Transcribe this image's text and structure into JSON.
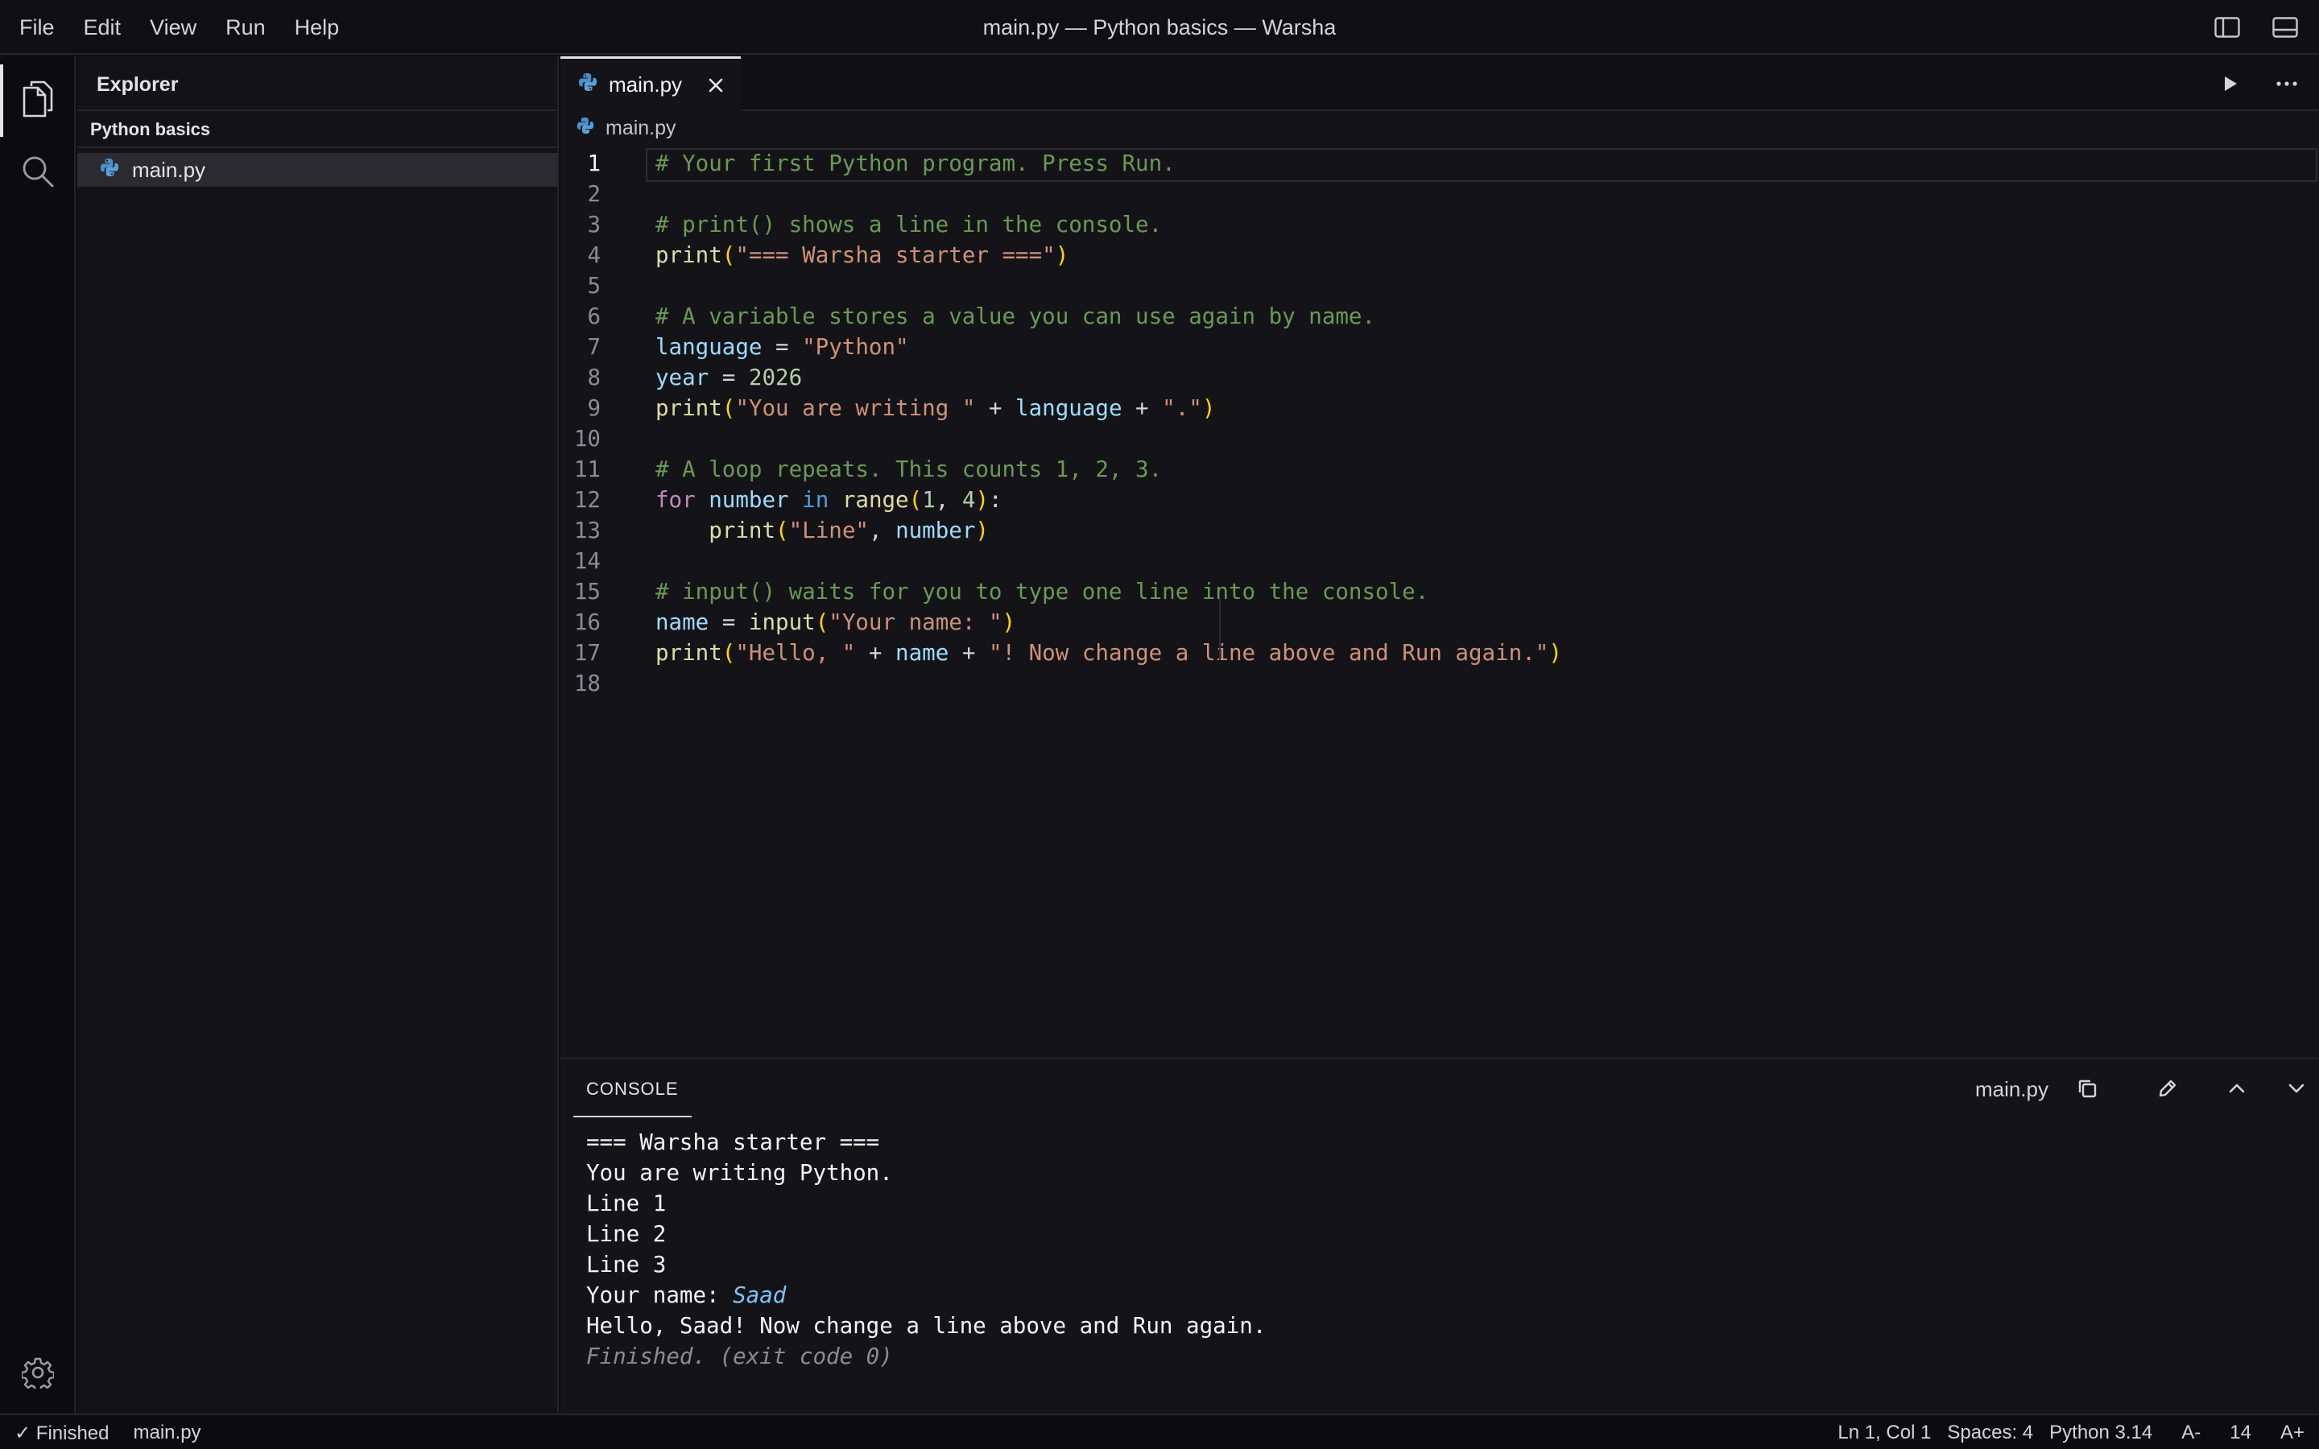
{
  "menu": [
    "File",
    "Edit",
    "View",
    "Run",
    "Help"
  ],
  "window_title": "main.py — Python basics — Warsha",
  "sidebar": {
    "header": "Explorer",
    "project": "Python basics",
    "files": [
      "main.py"
    ]
  },
  "editor": {
    "tab_label": "main.py",
    "breadcrumb": "main.py",
    "line_numbers": [
      "1",
      "2",
      "3",
      "4",
      "5",
      "6",
      "7",
      "8",
      "9",
      "10",
      "11",
      "12",
      "13",
      "14",
      "15",
      "16",
      "17",
      "18"
    ],
    "lines": [
      "# Your first Python program. Press Run.",
      "",
      "# print() shows a line in the console.",
      "print(\"=== Warsha starter ===\")",
      "",
      "# A variable stores a value you can use again by name.",
      "language = \"Python\"",
      "year = 2026",
      "print(\"You are writing \" + language + \".\")",
      "",
      "# A loop repeats. This counts 1, 2, 3.",
      "for number in range(1, 4):",
      "    print(\"Line\", number)",
      "",
      "# input() waits for you to type one line into the console.",
      "name = input(\"Your name: \")",
      "print(\"Hello, \" + name + \"! Now change a line above and Run again.\")",
      ""
    ],
    "tokens": {
      "c1": "# Your first Python program. Press Run.",
      "c3": "# print() shows a line in the console.",
      "c6": "# A variable stores a value you can use again by name.",
      "c11": "# A loop repeats. This counts 1, 2, 3.",
      "c15": "# input() waits for you to type one line into the console.",
      "print": "print",
      "input": "input",
      "range": "range",
      "for": "for",
      "in": "in",
      "language": "language",
      "year": "year",
      "number": "number",
      "name": "name",
      "eq": " = ",
      "plus": " + ",
      "lp": "(",
      "rp": ")",
      "comma": ", ",
      "colon": ":",
      "indent": "    ",
      "s_starter": "\"=== Warsha starter ===\"",
      "s_python": "\"Python\"",
      "n_2026": "2026",
      "s_writing": "\"You are writing \"",
      "s_dot": "\".\"",
      "n_1": "1",
      "n_4": "4",
      "s_line": "\"Line\"",
      "s_yourname": "\"Your name: \"",
      "s_hello": "\"Hello, \"",
      "s_now": "\"! Now change a line above and Run again.\""
    }
  },
  "console": {
    "tab_label": "CONSOLE",
    "file": "main.py",
    "output": [
      "=== Warsha starter ===",
      "You are writing Python.",
      "Line 1",
      "Line 2",
      "Line 3"
    ],
    "prompt": "Your name: ",
    "typed_input": "Saad",
    "greeting": "Hello, Saad! Now change a line above and Run again.",
    "finished": "Finished. (exit code 0)"
  },
  "statusbar": {
    "status": "✓ Finished",
    "file": "main.py",
    "position": "Ln 1, Col 1",
    "spaces": "Spaces: 4",
    "language": "Python 3.14",
    "font_decrease": "A-",
    "font_size": "14",
    "font_increase": "A+"
  },
  "icons": {
    "explorer": "files-icon",
    "search": "search-icon",
    "settings": "gear-icon",
    "run": "play-icon",
    "more": "more-icon",
    "copy": "copy-icon",
    "clear": "pencil-icon",
    "up": "chevron-up-icon",
    "down": "chevron-down-icon",
    "toggle_sidebar": "sidebar-toggle-icon",
    "toggle_panel": "panel-toggle-icon",
    "python": "python-icon"
  },
  "colors": {
    "background": "#0f0f12",
    "comment": "#6a9955",
    "string": "#ce9178",
    "function": "#dcdcaa",
    "variable": "#9cdcfe",
    "number": "#b5cea8",
    "keyword": "#c586c0",
    "bracket": "#ffd700",
    "input_text": "#7cc4ff"
  }
}
